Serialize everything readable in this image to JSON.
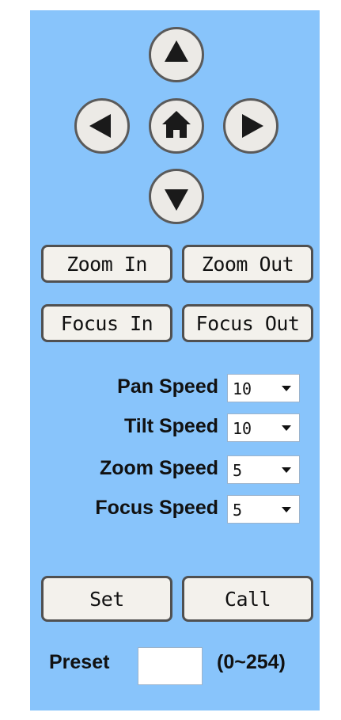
{
  "ptz": {
    "up_icon": "up-triangle-icon",
    "left_icon": "left-triangle-icon",
    "home_icon": "home-icon",
    "right_icon": "right-triangle-icon",
    "down_icon": "down-triangle-icon"
  },
  "buttons": {
    "zoom_in": "Zoom In",
    "zoom_out": "Zoom Out",
    "focus_in": "Focus In",
    "focus_out": "Focus Out",
    "set": "Set",
    "call": "Call"
  },
  "speeds": {
    "pan": {
      "label": "Pan Speed",
      "value": "10"
    },
    "tilt": {
      "label": "Tilt Speed",
      "value": "10"
    },
    "zoom": {
      "label": "Zoom Speed",
      "value": "5"
    },
    "focus": {
      "label": "Focus Speed",
      "value": "5"
    }
  },
  "preset": {
    "label": "Preset",
    "value": "",
    "range": "(0~254)"
  },
  "colors": {
    "panel_bg": "#88c4fb",
    "button_bg": "#f3f1ec",
    "border": "#505050"
  }
}
